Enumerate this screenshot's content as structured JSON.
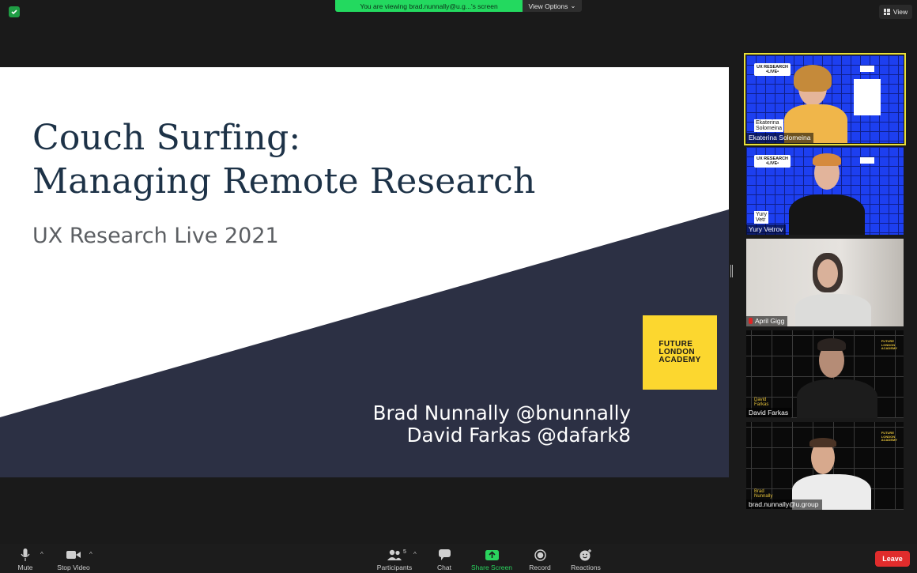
{
  "top_bar": {
    "viewing_banner": "You are viewing brad.nunnally@u.g...'s screen",
    "view_options": "View Options",
    "view_button": "View"
  },
  "slide": {
    "title_line1": "Couch Surfing:",
    "title_line2": "Managing Remote Research",
    "subtitle": "UX Research Live 2021",
    "presenter1": "Brad Nunnally @bnunnally",
    "presenter2": "David Farkas @dafark8",
    "logo_text": "FUTURE\nLONDON\nACADEMY",
    "colors": {
      "navy": "#2c3044",
      "title": "#1d3247",
      "logo": "#fcd72f"
    }
  },
  "participants": [
    {
      "name": "Ekaterina Solomeina",
      "badge": "UX RESEARCH\n•LIVE•",
      "inset_name": "Ekaterina\nSolomeina",
      "active": true
    },
    {
      "name": "Yury Vetrov",
      "badge": "UX RESEARCH\n•LIVE•",
      "inset_name": "Yury\nVetr"
    },
    {
      "name": "April Gigg",
      "muted": true
    },
    {
      "name": "David Farkas",
      "inset_name": "David\nFarkas",
      "corner": "FUTURE\nLONDON\nACADEMY"
    },
    {
      "name": "brad.nunnally@u.group",
      "inset_name": "Brad\nNunnally",
      "corner": "FUTURE\nLONDON\nACADEMY"
    }
  ],
  "toolbar": {
    "mute": "Mute",
    "stop_video": "Stop Video",
    "participants": "Participants",
    "participant_count": "5",
    "chat": "Chat",
    "share_screen": "Share Screen",
    "record": "Record",
    "reactions": "Reactions",
    "leave": "Leave"
  }
}
